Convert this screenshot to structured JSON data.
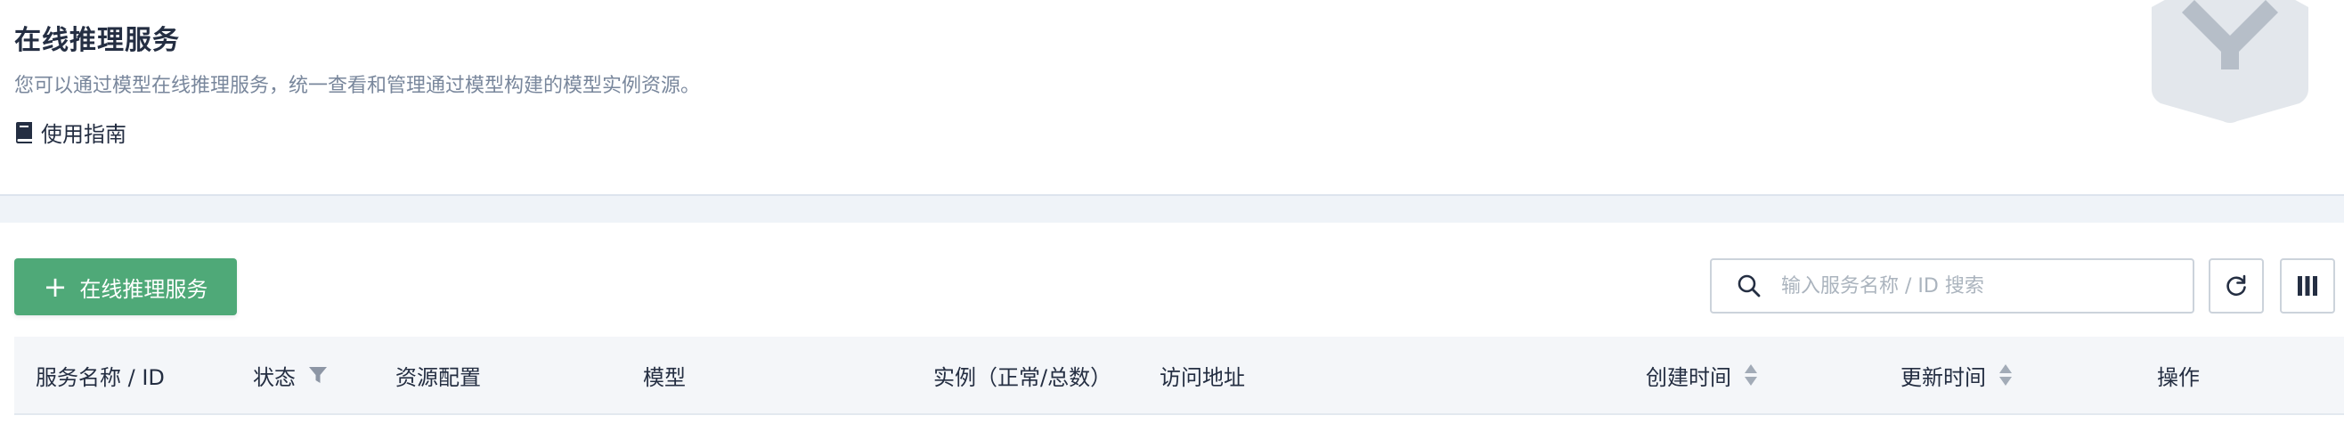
{
  "header": {
    "title": "在线推理服务",
    "description": "您可以通过模型在线推理服务，统一查看和管理通过模型构建的模型实例资源。",
    "guide_link": "使用指南"
  },
  "toolbar": {
    "create_label": "在线推理服务",
    "search_placeholder": "输入服务名称 / ID 搜索"
  },
  "table": {
    "columns": [
      {
        "label": "服务名称 / ID"
      },
      {
        "label": "状态",
        "icon": "filter-icon"
      },
      {
        "label": "资源配置"
      },
      {
        "label": "模型"
      },
      {
        "label": "实例（正常/总数）"
      },
      {
        "label": "访问地址"
      },
      {
        "label": "创建时间",
        "icon": "sort-icon"
      },
      {
        "label": "更新时间",
        "icon": "sort-icon"
      },
      {
        "label": "操作"
      }
    ]
  },
  "colors": {
    "primary": "#4fa978",
    "text": "#242e42",
    "muted": "#79879c",
    "band": "#eff3f8",
    "table_header": "#f4f6f9"
  }
}
